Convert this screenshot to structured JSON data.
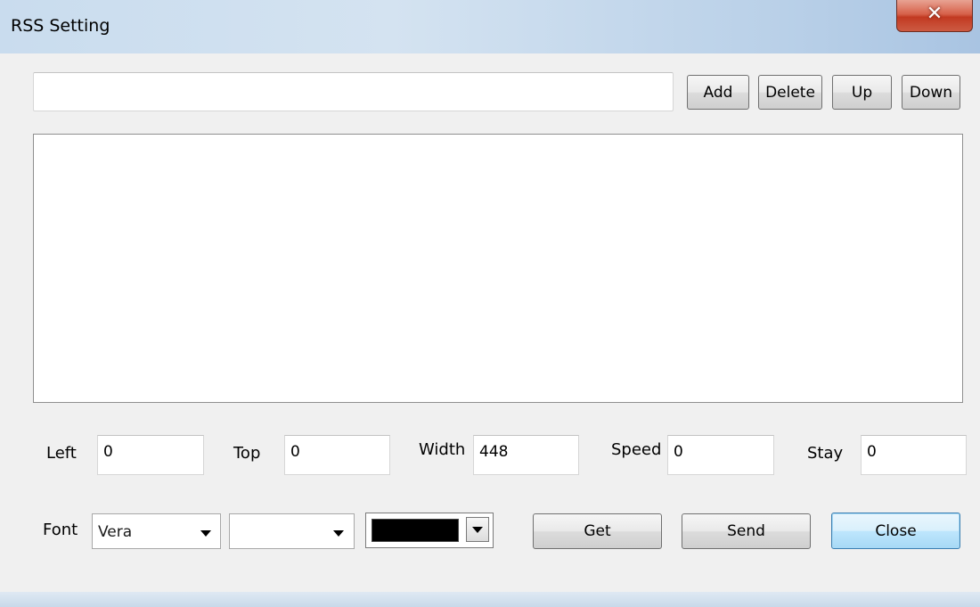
{
  "window": {
    "title": "RSS Setting",
    "close_glyph": "✕"
  },
  "url_input": {
    "value": "",
    "placeholder": ""
  },
  "toolbar": {
    "add": "Add",
    "delete": "Delete",
    "up": "Up",
    "down": "Down"
  },
  "fields": [
    {
      "label": "Left",
      "value": "0"
    },
    {
      "label": "Top",
      "value": "0"
    },
    {
      "label": "Width",
      "value": "448"
    },
    {
      "label": "Speed",
      "value": "0"
    },
    {
      "label": "Stay",
      "value": "0"
    }
  ],
  "font": {
    "label": "Font",
    "family_value": "Vera",
    "size_value": "",
    "color_value": "#000000"
  },
  "actions": {
    "get": "Get",
    "send": "Send",
    "close": "Close"
  }
}
